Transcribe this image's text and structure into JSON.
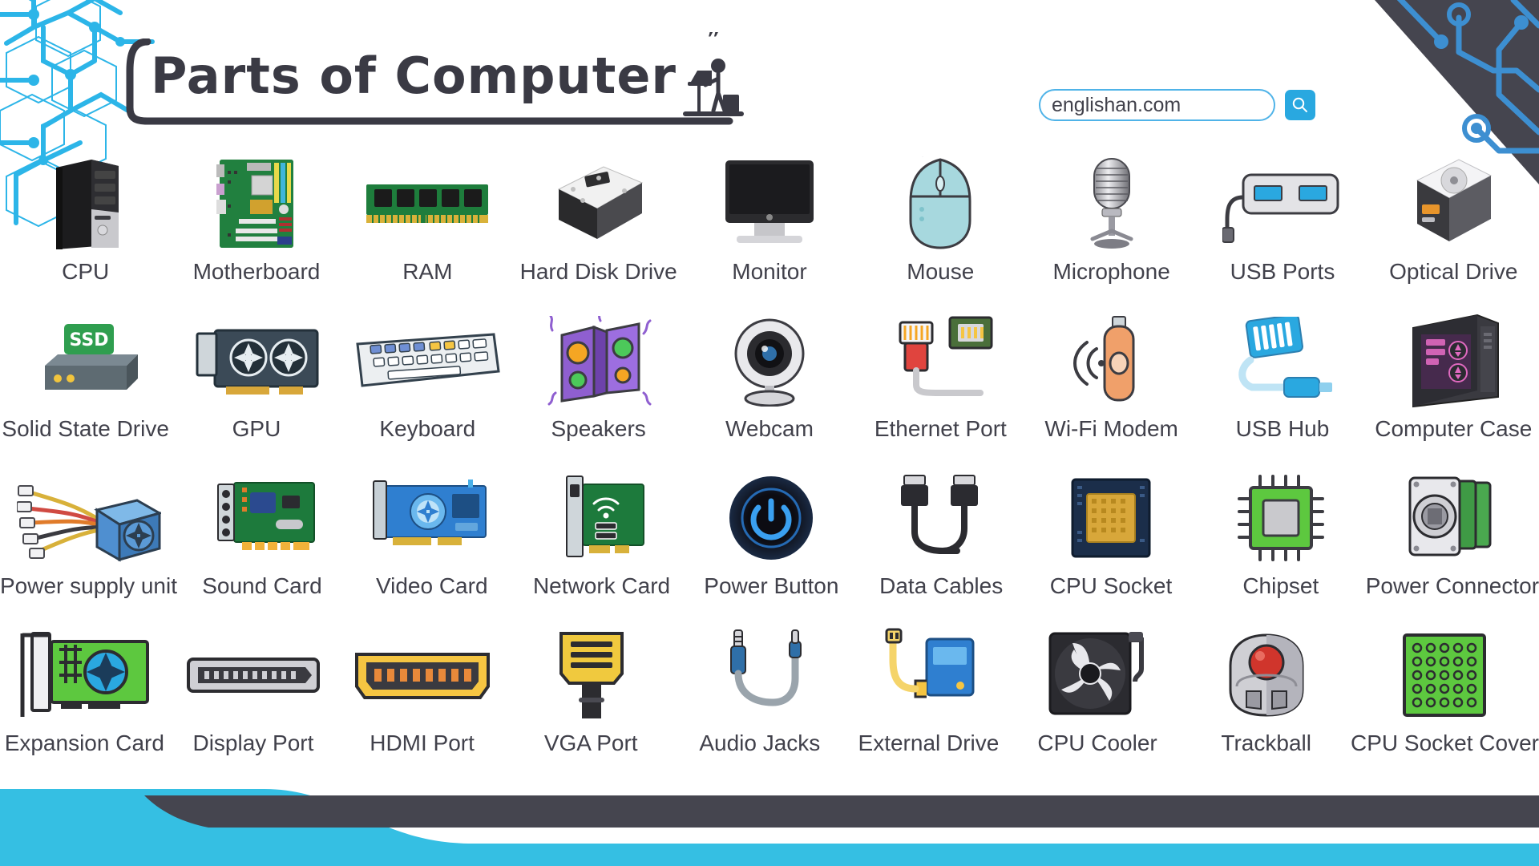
{
  "header": {
    "title": "Parts of Computer",
    "title_icon": "person-at-desk-icon",
    "decor_left": "hexagon-network-pattern",
    "decor_topright": "circuit-board-corner",
    "decor_bottom": "wave-footer-bar"
  },
  "search": {
    "value": "englishan.com",
    "placeholder": "englishan.com",
    "button_icon": "search-icon",
    "button_label": "Search"
  },
  "colors": {
    "accent_cyan": "#35bfe3",
    "accent_blue": "#29a8e0",
    "hex_blue": "#2cb5e8",
    "dark": "#45454f",
    "text": "#41414b",
    "background": "#ffffff"
  },
  "grid": {
    "columns": 9,
    "rows": 4,
    "items": [
      {
        "label": "CPU",
        "icon": "computer-tower-icon"
      },
      {
        "label": "Motherboard",
        "icon": "motherboard-icon"
      },
      {
        "label": "RAM",
        "icon": "memory-stick-icon"
      },
      {
        "label": "Hard Disk Drive",
        "icon": "hard-disk-icon"
      },
      {
        "label": "Monitor",
        "icon": "monitor-icon"
      },
      {
        "label": "Mouse",
        "icon": "mouse-icon"
      },
      {
        "label": "Microphone",
        "icon": "microphone-icon"
      },
      {
        "label": "USB Ports",
        "icon": "usb-ports-icon"
      },
      {
        "label": "Optical Drive",
        "icon": "optical-disc-drive-icon"
      },
      {
        "label": "Solid State Drive",
        "icon": "ssd-icon"
      },
      {
        "label": "GPU",
        "icon": "graphics-card-icon"
      },
      {
        "label": "Keyboard",
        "icon": "keyboard-icon"
      },
      {
        "label": "Speakers",
        "icon": "speakers-icon"
      },
      {
        "label": "Webcam",
        "icon": "webcam-icon"
      },
      {
        "label": "Ethernet Port",
        "icon": "ethernet-port-icon"
      },
      {
        "label": "Wi-Fi Modem",
        "icon": "wifi-modem-icon"
      },
      {
        "label": "USB Hub",
        "icon": "usb-hub-icon"
      },
      {
        "label": "Computer Case",
        "icon": "computer-case-icon"
      },
      {
        "label": "Power supply unit",
        "icon": "power-supply-unit-icon"
      },
      {
        "label": "Sound Card",
        "icon": "sound-card-icon"
      },
      {
        "label": "Video Card",
        "icon": "video-card-icon"
      },
      {
        "label": "Network Card",
        "icon": "network-card-icon"
      },
      {
        "label": "Power Button",
        "icon": "power-button-icon"
      },
      {
        "label": "Data Cables",
        "icon": "data-cable-icon"
      },
      {
        "label": "CPU Socket",
        "icon": "cpu-socket-icon"
      },
      {
        "label": "Chipset",
        "icon": "chipset-icon"
      },
      {
        "label": "Power Connector",
        "icon": "power-connector-icon"
      },
      {
        "label": "Expansion Card",
        "icon": "expansion-card-icon"
      },
      {
        "label": "Display Port",
        "icon": "display-port-icon"
      },
      {
        "label": "HDMI Port",
        "icon": "hdmi-port-icon"
      },
      {
        "label": "VGA Port",
        "icon": "vga-port-icon"
      },
      {
        "label": "Audio Jacks",
        "icon": "audio-jack-icon"
      },
      {
        "label": "External Drive",
        "icon": "external-drive-icon"
      },
      {
        "label": "CPU Cooler",
        "icon": "cpu-cooler-fan-icon"
      },
      {
        "label": "Trackball",
        "icon": "trackball-icon"
      },
      {
        "label": "CPU Socket Cover",
        "icon": "cpu-socket-cover-icon"
      }
    ]
  }
}
